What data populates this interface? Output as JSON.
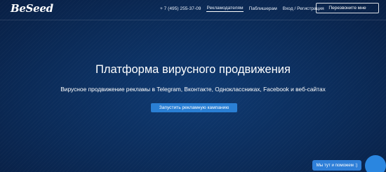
{
  "header": {
    "logo_text": "BeSeed",
    "phone": "+ 7 (495) 255-37-09",
    "nav_items": [
      {
        "label": "Рекламодателям",
        "active": true
      },
      {
        "label": "Паблишерам",
        "active": false
      },
      {
        "label": "Вход / Регистрация",
        "active": false
      }
    ],
    "callback_label": "Перезвоните мне"
  },
  "hero": {
    "title": "Платформа вирусного продвижения",
    "subtitle": "Вирусное продвижение рекламы в Telegram, Вконтакте, Одноклассниках, Facebook и веб-сайтах",
    "cta_label": "Запустить рекламную кампанию"
  },
  "chat": {
    "label": "Мы тут и поможем :)",
    "icon": "chat-icon"
  },
  "colors": {
    "background": "#0b2c5a",
    "accent": "#2a7fd4"
  }
}
